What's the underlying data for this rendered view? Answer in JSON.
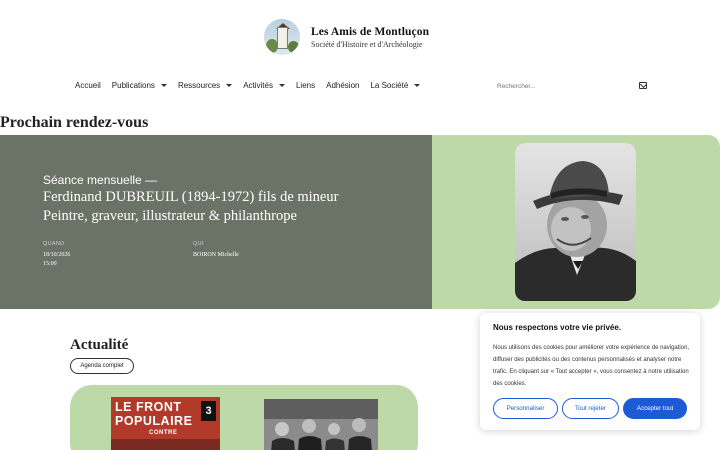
{
  "site": {
    "title": "Les Amis de Montluçon",
    "subtitle": "Société d'Histoire et d'Archéologie"
  },
  "nav": {
    "items": [
      {
        "label": "Accueil",
        "dropdown": false
      },
      {
        "label": "Publications",
        "dropdown": true
      },
      {
        "label": "Ressources",
        "dropdown": true
      },
      {
        "label": "Activités",
        "dropdown": true
      },
      {
        "label": "Liens",
        "dropdown": false
      },
      {
        "label": "Adhésion",
        "dropdown": false
      },
      {
        "label": "La Société",
        "dropdown": true
      }
    ],
    "search_placeholder": "Rechercher..."
  },
  "event_section": {
    "heading": "Prochain rendez-vous",
    "kicker": "Séance mensuelle —",
    "line1": "Ferdinand DUBREUIL (1894-1972) fils de mineur",
    "line2": "Peintre, graveur, illustrateur & philanthrope",
    "when_label": "QUAND",
    "when_date": "18/10/2026",
    "when_time": "15:00",
    "who_label": "QUI",
    "who_value": "BOIRON Michelle"
  },
  "news": {
    "heading": "Actualité",
    "agenda_button": "Agenda complet",
    "poster_line1": "LE FRONT",
    "poster_line2": "POPULAIRE",
    "poster_line3": "CONTRE",
    "poster_number": "3"
  },
  "cookie": {
    "title": "Nous respectons votre vie privée.",
    "body": "Nous utilisons des cookies pour améliorer votre expérience de navigation, diffuser des publicités ou des contenus personnalisés et analyser notre trafic. En cliquant sur « Tout accepter », vous consentez à notre utilisation des cookies.",
    "customize": "Personnaliser",
    "reject": "Tout rejeter",
    "accept": "Accepter tout"
  },
  "colors": {
    "event_dark": "#6b7266",
    "accent_green": "#bdd9a8",
    "button_blue": "#1d5bd6"
  }
}
